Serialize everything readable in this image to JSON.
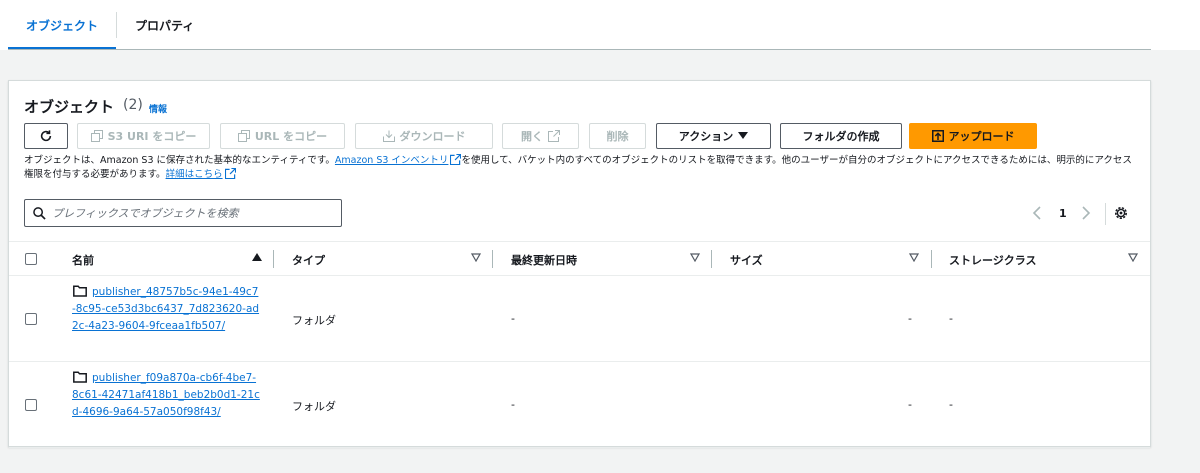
{
  "tabs": [
    {
      "label": "オブジェクト"
    },
    {
      "label": "プロパティ"
    }
  ],
  "panel": {
    "title": "オブジェクト",
    "count": "(2)",
    "info_label": "情報"
  },
  "toolbar": {
    "refresh_icon": "refresh-icon",
    "copy_s3_uri": "S3 URI をコピー",
    "copy_url": "URL をコピー",
    "download": "ダウンロード",
    "open": "開く",
    "delete": "削除",
    "actions": "アクション",
    "create_folder": "フォルダの作成",
    "upload": "アップロード"
  },
  "description": {
    "part1": "オブジェクトは、Amazon S3 に保存された基本的なエンティティです。",
    "inventory_link": "Amazon S3 インベントリ",
    "part2": "を使用して、バケット内のすべてのオブジェクトのリストを取得できます。他のユーザーが自分のオブジェクトにアクセスできるためには、明示的にアクセス権限を付与する必要があります。",
    "details_link": "詳細はこちら"
  },
  "search": {
    "placeholder": "プレフィックスでオブジェクトを検索",
    "value": ""
  },
  "pagination": {
    "current_page": "1"
  },
  "table": {
    "columns": [
      {
        "label": "名前"
      },
      {
        "label": "タイプ"
      },
      {
        "label": "最終更新日時"
      },
      {
        "label": "サイズ"
      },
      {
        "label": "ストレージクラス"
      }
    ],
    "rows": [
      {
        "name": "publisher_48757b5c-94e1-49c7-8c95-ce53d3bc6437_7d823620-ad2c-4a23-9604-9fceaa1fb507/",
        "type": "フォルダ",
        "modified": "-",
        "size": "-",
        "storage_class": "-"
      },
      {
        "name": "publisher_f09a870a-cb6f-4be7-8c61-42471af418b1_beb2b0d1-21cd-4696-9a64-57a050f98f43/",
        "type": "フォルダ",
        "modified": "-",
        "size": "-",
        "storage_class": "-"
      }
    ]
  },
  "colors": {
    "accent": "#0972d3",
    "primary_button": "#ff9900",
    "text": "#16191f",
    "disabled": "#aab7b8",
    "border": "#545b64"
  }
}
